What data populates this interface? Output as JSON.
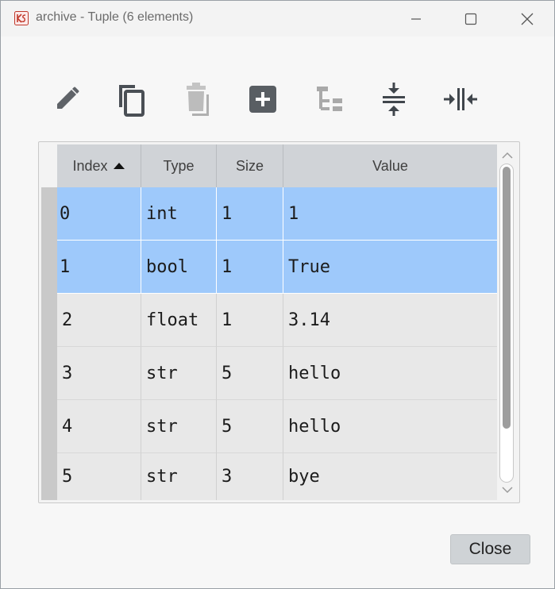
{
  "window": {
    "title": "archive - Tuple (6 elements)",
    "controls": [
      "minimize-icon",
      "maximize-icon",
      "close-icon"
    ]
  },
  "toolbar": {
    "buttons": [
      {
        "name": "edit-button",
        "icon": "pencil-icon",
        "enabled": true
      },
      {
        "name": "copy-button",
        "icon": "copy-icon",
        "enabled": true
      },
      {
        "name": "delete-button",
        "icon": "trash-icon",
        "enabled": false
      },
      {
        "name": "insert-button",
        "icon": "plus-box-icon",
        "enabled": true
      },
      {
        "name": "tree-button",
        "icon": "tree-icon",
        "enabled": false
      },
      {
        "name": "collapse-button",
        "icon": "collapse-vertical-icon",
        "enabled": true
      },
      {
        "name": "resize-columns-button",
        "icon": "collapse-horizontal-icon",
        "enabled": true
      }
    ]
  },
  "table": {
    "headers": {
      "index": "Index",
      "type": "Type",
      "size": "Size",
      "value": "Value"
    },
    "sort_indicator": "ascending",
    "rows": [
      {
        "index": "0",
        "type": "int",
        "size": "1",
        "value": "1",
        "selected": true
      },
      {
        "index": "1",
        "type": "bool",
        "size": "1",
        "value": "True",
        "selected": true
      },
      {
        "index": "2",
        "type": "float",
        "size": "1",
        "value": "3.14",
        "selected": false
      },
      {
        "index": "3",
        "type": "str",
        "size": "5",
        "value": "hello",
        "selected": false
      },
      {
        "index": "4",
        "type": "str",
        "size": "5",
        "value": "hello",
        "selected": false
      },
      {
        "index": "5",
        "type": "str",
        "size": "3",
        "value": "bye",
        "selected": false
      }
    ]
  },
  "footer": {
    "close_label": "Close"
  },
  "colors": {
    "selection": "#9ec9fb",
    "header": "#d0d3d7",
    "row": "#e8e8e8"
  }
}
